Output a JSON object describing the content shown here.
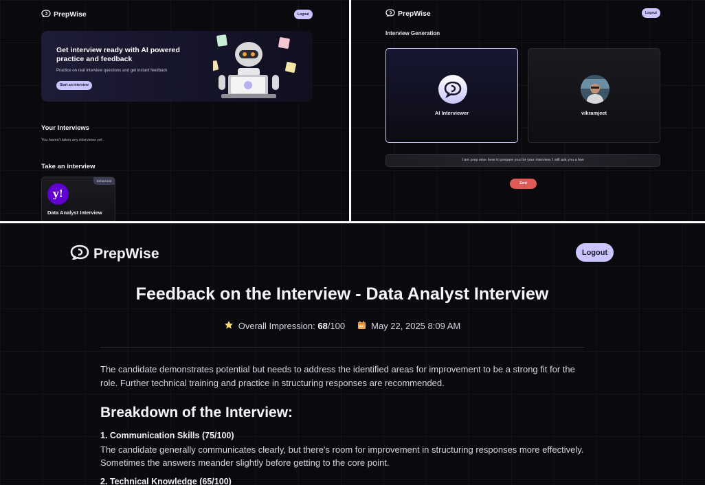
{
  "brand": {
    "name": "PrepWise"
  },
  "colors": {
    "accent": "#cac5fe",
    "danger": "#e05a5a",
    "background": "#0a0a0e",
    "company_logo": "#6001d2"
  },
  "dashboard": {
    "logout_label": "Logout",
    "hero": {
      "title": "Get interview ready with AI powered practice and feedback",
      "subtitle": "Practice on real interview questions and get instant feedback",
      "cta_label": "Start an interview"
    },
    "your_interviews": {
      "title": "Your Interviews",
      "empty_text": "You haven't taken any interviews yet"
    },
    "take_interview": {
      "title": "Take an interview",
      "card": {
        "tag": "Behavioral",
        "company_logo_text": "y!",
        "title": "Data Analyst Interview"
      }
    }
  },
  "interview": {
    "logout_label": "Logout",
    "section_title": "Interview Generation",
    "ai_label": "AI Interviewer",
    "user_label": "vikramjeet",
    "transcript": "I am prep wise here to prepare you for your interview. I will ask you a few",
    "end_label": "End"
  },
  "feedback": {
    "logout_label": "Logout",
    "title": "Feedback on the Interview - Data Analyst Interview",
    "impression_label": "Overall Impression:",
    "score": "68",
    "score_total": "/100",
    "date": "May 22, 2025 8:09 AM",
    "summary": "The candidate demonstrates potential but needs to address the identified areas for improvement to be a strong fit for the role. Further technical training and practice in structuring responses are recommended.",
    "breakdown_title": "Breakdown of the Interview:",
    "items": [
      {
        "title": "1. Communication Skills (75/100)",
        "text": "The candidate generally communicates clearly, but there's room for improvement in structuring responses more effectively. Sometimes the answers meander slightly before getting to the core point."
      },
      {
        "title": "2. Technical Knowledge (65/100)",
        "text": ""
      }
    ]
  }
}
